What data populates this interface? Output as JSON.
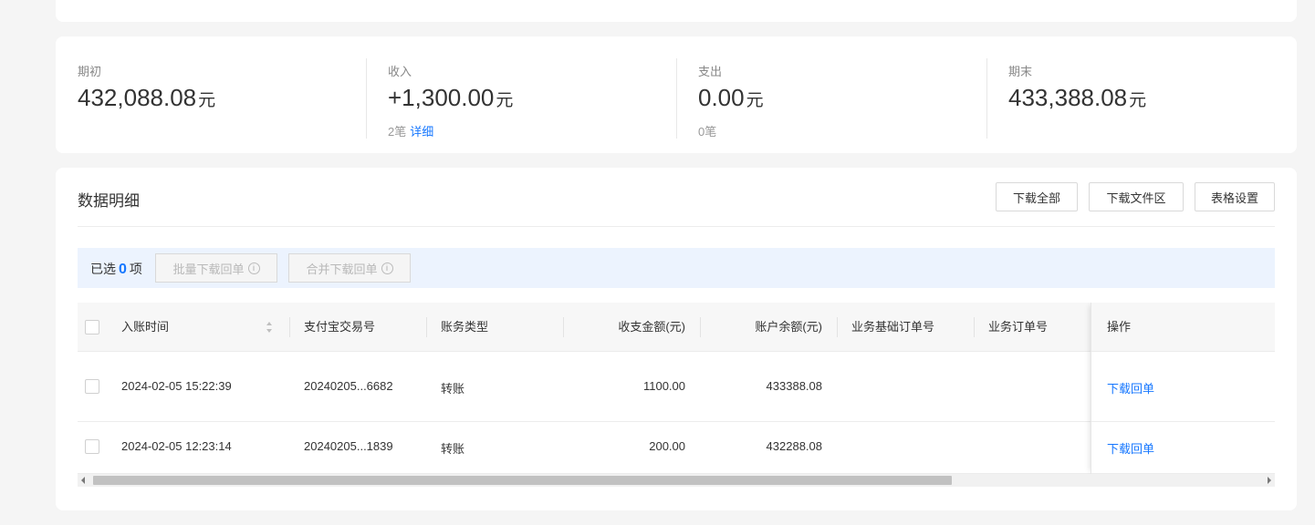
{
  "summary": {
    "opening": {
      "label": "期初",
      "amount": "432,088.08",
      "unit": "元"
    },
    "income": {
      "label": "收入",
      "amount": "+1,300.00",
      "unit": "元",
      "count": "2笔",
      "detail_link": "详细"
    },
    "expense": {
      "label": "支出",
      "amount": "0.00",
      "unit": "元",
      "count": "0笔"
    },
    "closing": {
      "label": "期末",
      "amount": "433,388.08",
      "unit": "元"
    }
  },
  "details": {
    "title": "数据明细",
    "buttons": {
      "download_all": "下载全部",
      "download_area": "下载文件区",
      "table_settings": "表格设置"
    },
    "selection": {
      "prefix": "已选",
      "count": "0",
      "suffix": "项",
      "batch_download": "批量下载回单",
      "merge_download": "合并下载回单",
      "info_glyph": "i"
    },
    "columns": {
      "time": "入账时间",
      "trade_no": "支付宝交易号",
      "type": "账务类型",
      "amount": "收支金额(元)",
      "balance": "账户余额(元)",
      "base_order": "业务基础订单号",
      "order": "业务订单号",
      "op": "操作"
    },
    "rows": [
      {
        "time": "2024-02-05 15:22:39",
        "trade_no": "20240205...6682",
        "type": "转账",
        "amount": "1100.00",
        "balance": "433388.08",
        "base_order": "",
        "order": "",
        "op": "下载回单"
      },
      {
        "time": "2024-02-05 12:23:14",
        "trade_no": "20240205...1839",
        "type": "转账",
        "amount": "200.00",
        "balance": "432288.08",
        "base_order": "",
        "order": "",
        "op": "下载回单"
      }
    ]
  },
  "colors": {
    "accent": "#1677ff",
    "selection_bg": "#ecf3fe",
    "page_bg": "#f5f5f5"
  }
}
